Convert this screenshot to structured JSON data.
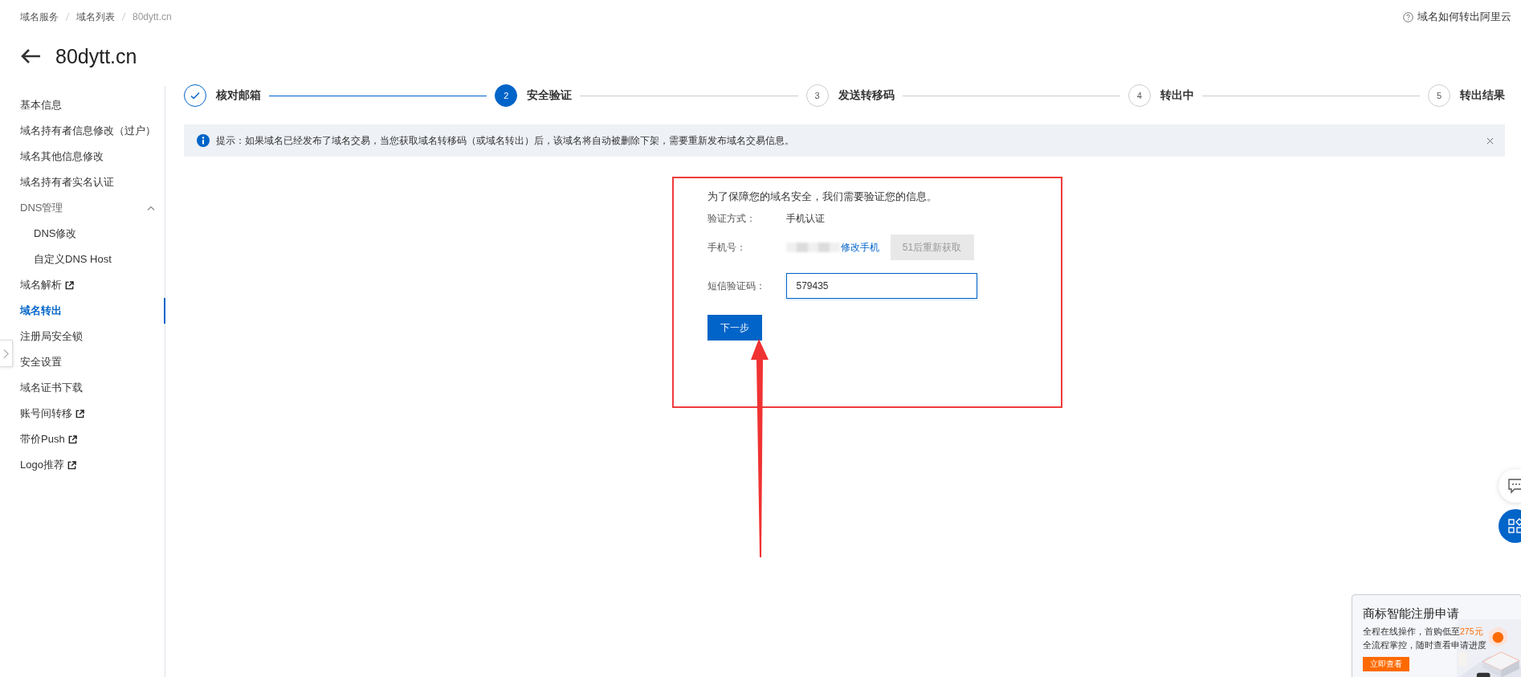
{
  "breadcrumb": [
    {
      "label": "域名服务",
      "current": false
    },
    {
      "label": "域名列表",
      "current": false
    },
    {
      "label": "80dytt.cn",
      "current": true
    }
  ],
  "help_link": "域名如何转出阿里云",
  "title": "80dytt.cn",
  "sidebar": {
    "items": [
      {
        "label": "基本信息",
        "selected": false,
        "external": false
      },
      {
        "label": "域名持有者信息修改（过户）",
        "selected": false,
        "external": false
      },
      {
        "label": "域名其他信息修改",
        "selected": false,
        "external": false
      },
      {
        "label": "域名持有者实名认证",
        "selected": false,
        "external": false
      },
      {
        "label": "DNS管理",
        "expanded": true,
        "children": [
          {
            "label": "DNS修改",
            "selected": false,
            "external": false
          },
          {
            "label": "自定义DNS Host",
            "selected": false,
            "external": false
          }
        ]
      },
      {
        "label": "域名解析",
        "selected": false,
        "external": true
      },
      {
        "label": "域名转出",
        "selected": true,
        "external": false
      },
      {
        "label": "注册局安全锁",
        "selected": false,
        "external": false
      },
      {
        "label": "安全设置",
        "selected": false,
        "external": false
      },
      {
        "label": "域名证书下载",
        "selected": false,
        "external": false
      },
      {
        "label": "账号间转移",
        "selected": false,
        "external": true
      },
      {
        "label": "带价Push",
        "selected": false,
        "external": true
      },
      {
        "label": "Logo推荐",
        "selected": false,
        "external": true
      }
    ]
  },
  "steps": [
    {
      "label": "核对邮箱",
      "done": true,
      "selected": false
    },
    {
      "number": "2",
      "label": "安全验证",
      "done": false,
      "selected": true
    },
    {
      "number": "3",
      "label": "发送转移码",
      "done": false,
      "selected": false
    },
    {
      "number": "4",
      "label": "转出中",
      "done": false,
      "selected": false
    },
    {
      "number": "5",
      "label": "转出结果",
      "done": false,
      "selected": false
    }
  ],
  "alert": {
    "text": "提示：如果域名已经发布了域名交易，当您获取域名转移码（或域名转出）后，该域名将自动被删除下架，需要重新发布域名交易信息。"
  },
  "form": {
    "intro": "为了保障您的域名安全，我们需要验证您的信息。",
    "method_label": "验证方式：",
    "method_value": "手机认证",
    "phone_label": "手机号：",
    "change_phone": "修改手机",
    "resend_button": {
      "label": "51后重新获取",
      "disabled": true
    },
    "code_label": "短信验证码：",
    "code_value": "579435",
    "next_button": "下一步"
  },
  "ad": {
    "title": "商标智能注册申请",
    "line1": "全程在线操作，首购低至",
    "price": "275元",
    "line2": "全流程掌控，随时查看申请进度",
    "button": "立即查看"
  }
}
